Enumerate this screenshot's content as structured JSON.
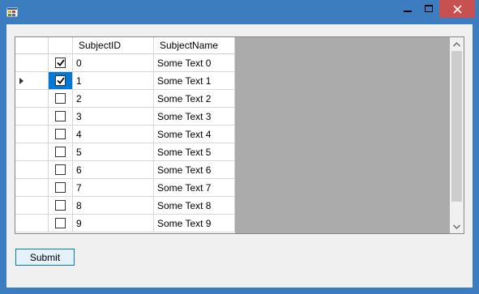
{
  "window": {
    "icons": {
      "app": "app-icon",
      "minimize": "minimize-icon",
      "maximize": "maximize-icon",
      "close": "close-icon"
    }
  },
  "grid": {
    "columns": [
      "SubjectID",
      "SubjectName"
    ],
    "rows": [
      {
        "checked": true,
        "id": "0",
        "name": "Some Text 0"
      },
      {
        "checked": true,
        "id": "1",
        "name": "Some Text 1",
        "current": true
      },
      {
        "checked": false,
        "id": "2",
        "name": "Some Text 2"
      },
      {
        "checked": false,
        "id": "3",
        "name": "Some Text 3"
      },
      {
        "checked": false,
        "id": "4",
        "name": "Some Text 4"
      },
      {
        "checked": false,
        "id": "5",
        "name": "Some Text 5"
      },
      {
        "checked": false,
        "id": "6",
        "name": "Some Text 6"
      },
      {
        "checked": false,
        "id": "7",
        "name": "Some Text 7"
      },
      {
        "checked": false,
        "id": "8",
        "name": "Some Text 8"
      },
      {
        "checked": false,
        "id": "9",
        "name": "Some Text 9"
      }
    ]
  },
  "submit_label": "Submit",
  "colors": {
    "titlebar": "#3c7dc0",
    "close": "#c75050",
    "selection": "#0078d7",
    "grid_bg": "#ababab"
  }
}
